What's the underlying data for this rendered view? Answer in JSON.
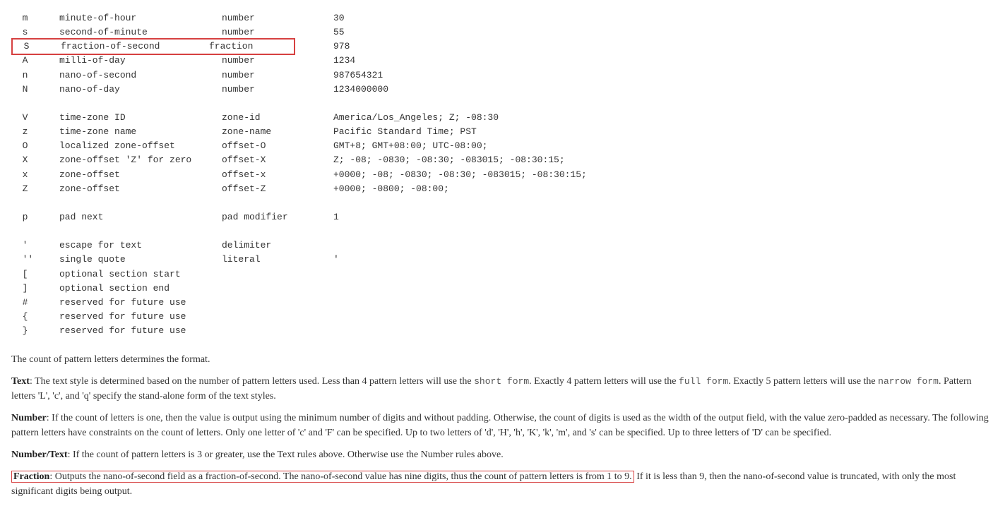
{
  "rows": [
    {
      "sym": "m",
      "meaning": "minute-of-hour",
      "type": "number",
      "ex": "30",
      "hl": false
    },
    {
      "sym": "s",
      "meaning": "second-of-minute",
      "type": "number",
      "ex": "55",
      "hl": false
    },
    {
      "sym": "S",
      "meaning": "fraction-of-second",
      "type": "fraction",
      "ex": "978",
      "hl": true
    },
    {
      "sym": "A",
      "meaning": "milli-of-day",
      "type": "number",
      "ex": "1234",
      "hl": false
    },
    {
      "sym": "n",
      "meaning": "nano-of-second",
      "type": "number",
      "ex": "987654321",
      "hl": false
    },
    {
      "sym": "N",
      "meaning": "nano-of-day",
      "type": "number",
      "ex": "1234000000",
      "hl": false
    },
    {
      "blank": true
    },
    {
      "sym": "V",
      "meaning": "time-zone ID",
      "type": "zone-id",
      "ex": "America/Los_Angeles; Z; -08:30",
      "hl": false
    },
    {
      "sym": "z",
      "meaning": "time-zone name",
      "type": "zone-name",
      "ex": "Pacific Standard Time; PST",
      "hl": false
    },
    {
      "sym": "O",
      "meaning": "localized zone-offset",
      "type": "offset-O",
      "ex": "GMT+8; GMT+08:00; UTC-08:00;",
      "hl": false
    },
    {
      "sym": "X",
      "meaning": "zone-offset 'Z' for zero",
      "type": "offset-X",
      "ex": "Z; -08; -0830; -08:30; -083015; -08:30:15;",
      "hl": false
    },
    {
      "sym": "x",
      "meaning": "zone-offset",
      "type": "offset-x",
      "ex": "+0000; -08; -0830; -08:30; -083015; -08:30:15;",
      "hl": false
    },
    {
      "sym": "Z",
      "meaning": "zone-offset",
      "type": "offset-Z",
      "ex": "+0000; -0800; -08:00;",
      "hl": false
    },
    {
      "blank": true
    },
    {
      "sym": "p",
      "meaning": "pad next",
      "type": "pad modifier",
      "ex": "1",
      "hl": false
    },
    {
      "blank": true
    },
    {
      "sym": "'",
      "meaning": "escape for text",
      "type": "delimiter",
      "ex": "",
      "hl": false
    },
    {
      "sym": "''",
      "meaning": "single quote",
      "type": "literal",
      "ex": "'",
      "hl": false
    },
    {
      "sym": "[",
      "meaning": "optional section start",
      "type": "",
      "ex": "",
      "hl": false
    },
    {
      "sym": "]",
      "meaning": "optional section end",
      "type": "",
      "ex": "",
      "hl": false
    },
    {
      "sym": "#",
      "meaning": "reserved for future use",
      "type": "",
      "ex": "",
      "hl": false
    },
    {
      "sym": "{",
      "meaning": "reserved for future use",
      "type": "",
      "ex": "",
      "hl": false
    },
    {
      "sym": "}",
      "meaning": "reserved for future use",
      "type": "",
      "ex": "",
      "hl": false
    }
  ],
  "para_intro": "The count of pattern letters determines the format.",
  "text_label": "Text",
  "text_body1": ": The text style is determined based on the number of pattern letters used. Less than 4 pattern letters will use the ",
  "short_form": "short form",
  "text_body2": ". Exactly 4 pattern letters will use the ",
  "full_form": "full form",
  "text_body3": ". Exactly 5 pattern letters will use the ",
  "narrow_form": "narrow form",
  "text_body4": ". Pattern letters 'L', 'c', and 'q' specify the stand-alone form of the text styles.",
  "number_label": "Number",
  "number_body": ": If the count of letters is one, then the value is output using the minimum number of digits and without padding. Otherwise, the count of digits is used as the width of the output field, with the value zero-padded as necessary. The following pattern letters have constraints on the count of letters. Only one letter of 'c' and 'F' can be specified. Up to two letters of 'd', 'H', 'h', 'K', 'k', 'm', and 's' can be specified. Up to three letters of 'D' can be specified.",
  "numtext_label": "Number/Text",
  "numtext_body": ": If the count of pattern letters is 3 or greater, use the Text rules above. Otherwise use the Number rules above.",
  "fraction_label": "Fraction",
  "fraction_hl": ": Outputs the nano-of-second field as a fraction-of-second. The nano-of-second value has nine digits, thus the count of pattern letters is from 1 to 9.",
  "fraction_tail": " If it is less than 9, then the nano-of-second value is truncated, with only the most significant digits being output."
}
